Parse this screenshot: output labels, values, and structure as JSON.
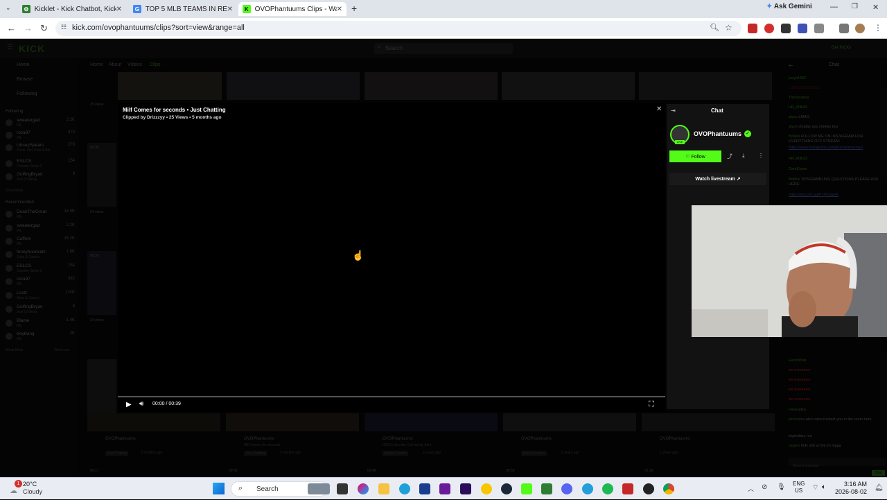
{
  "browser": {
    "tabs": [
      {
        "label": "Kicklet - Kick Chatbot, Kick Wi",
        "active": false
      },
      {
        "label": "TOP 5 MLB TEAMS IN REVENUE",
        "active": false
      },
      {
        "label": "OVOPhantuums Clips - Wa",
        "active": true
      }
    ],
    "new_tab": "+",
    "ask_gemini": "Ask Gemini",
    "url": "kick.com/ovophantuums/clips?sort=view&range=all"
  },
  "kick": {
    "logo": "KICK",
    "search_placeholder": "Search",
    "get_kicks": "Get KICKs",
    "nav": {
      "home": "Home",
      "browse": "Browse",
      "following": "Following"
    },
    "channel_nav": [
      "Home",
      "About",
      "Videos",
      "Clips"
    ],
    "following_header": "Following",
    "following": [
      {
        "name": "sweatergad",
        "sub": "IRL",
        "count": "2.2K"
      },
      {
        "name": "roza97",
        "sub": "IRL",
        "count": "370"
      },
      {
        "name": "LibseySpears",
        "sub": "Pools, Hot Tubs & Bik.",
        "count": "278"
      },
      {
        "name": "ESLCS",
        "sub": "Counter-Strike 2",
        "count": "154"
      },
      {
        "name": "GolfingBryan",
        "sub": "Just Chatting",
        "count": "8"
      }
    ],
    "show_more": "Show More",
    "recommended_header": "Recommended",
    "recommended": [
      {
        "name": "DeanTheGreat",
        "sub": "IRL",
        "count": "14.5K"
      },
      {
        "name": "sweatergad",
        "sub": "IRL",
        "count": "2.2K"
      },
      {
        "name": "Cuffem",
        "sub": "IRL",
        "count": "16.2K"
      },
      {
        "name": "funnyhoodvidz",
        "sub": "Slots & Casino",
        "count": "1.8K"
      },
      {
        "name": "ESLCS",
        "sub": "Counter-Strike 2",
        "count": "154"
      },
      {
        "name": "roza97",
        "sub": "IRL",
        "count": "382"
      },
      {
        "name": "Loslz",
        "sub": "Slots & Casino",
        "count": "LIVE"
      },
      {
        "name": "GolfingBryan",
        "sub": "Just Chatting",
        "count": "8"
      },
      {
        "name": "Blame",
        "sub": "IRL",
        "count": "1.4K"
      },
      {
        "name": "treyliving",
        "sub": "IRL",
        "count": "2K"
      }
    ],
    "show_less": "View Less",
    "views_label": "24 views",
    "duration_a": "00:36",
    "duration_b": "00:30",
    "views_25": "25 views"
  },
  "clip": {
    "title": "Milf Comes for seconds • Just Chatting",
    "meta": "Clipped by Drizzzyy • 25 Views • 5 months ago",
    "time": "00:00 / 00:39",
    "progress": 0
  },
  "panel": {
    "header": "Chat",
    "channel": "OVOPhantuums",
    "live": "LIVE",
    "follow": "Follow",
    "watch_livestream": "Watch livestream"
  },
  "chat": {
    "header": "Chat",
    "lines": [
      {
        "u": "joeyb1552",
        "t": ""
      },
      {
        "u": "",
        "t": ":LOOOOOOOOOL"
      },
      {
        "u": "TheSinatras",
        "t": ""
      },
      {
        "u": "HR_Milk33",
        "t": ""
      },
      {
        "u": "alyex",
        "t": "LMAO"
      },
      {
        "u": "alyex",
        "t": "chubby ass cheeks boy"
      },
      {
        "u": "BotRix",
        "t": "FOLLOW ME ON INSTAGRAM FOR EVERYTHING OFF STREAM:"
      },
      {
        "u": "",
        "t": "https://www.instagram.com/phantuumsclips/"
      },
      {
        "u": "HR_Milk33",
        "t": ""
      },
      {
        "u": "DarkGame",
        "t": ""
      },
      {
        "u": "BotRix",
        "t": "TIPS/GAMBLING QUESTIONS PLEASE ASK HERE:"
      },
      {
        "u": "",
        "t": "https://discord.gg/PT4Vydp42"
      }
    ],
    "lines_bottom": [
      {
        "u": "EazyWhat",
        "t": ""
      },
      {
        "u": "",
        "t": ""
      },
      {
        "u": "",
        "t": ""
      },
      {
        "u": "",
        "t": ""
      },
      {
        "u": "",
        "t": ""
      },
      {
        "u": "reneradka",
        "t": ""
      },
      {
        "u": "pincoulos",
        "t": "also nana fuckest you in the room here"
      },
      {
        "u": "",
        "t": "legendary run"
      },
      {
        "u": "siggen",
        "t": "holy shit ur the lm nigga"
      }
    ],
    "input_placeholder": "Send a message",
    "send": "Chat"
  },
  "grid": {
    "card_titles": [
      "OVOPhantuums",
      "OVOPhantuums",
      "OVOPhantuums",
      "OVOPhantuums",
      "OVOPhantuums"
    ],
    "card_subs": [
      "Milf Comes for seconds",
      "IOOOz Secrets Call-out by Akro",
      "",
      ""
    ],
    "card_tags": [
      "Just Chatting",
      "Just Chatting",
      "Slots & Casino",
      "Slots & Casino",
      ""
    ],
    "card_ages": [
      "5 months ago",
      "3 months ago",
      "2 years ago",
      "2 years ago",
      "2 years ago"
    ],
    "durations": [
      "00:17",
      "00:56",
      "00:40",
      "00:50",
      "03:16"
    ]
  },
  "taskbar": {
    "weather_temp": "20°C",
    "weather_desc": "Cloudy",
    "weather_badge": "1",
    "search": "Search",
    "lang1": "ENG",
    "lang2": "US",
    "time": "3:16 AM",
    "date": "2026-08-02"
  }
}
